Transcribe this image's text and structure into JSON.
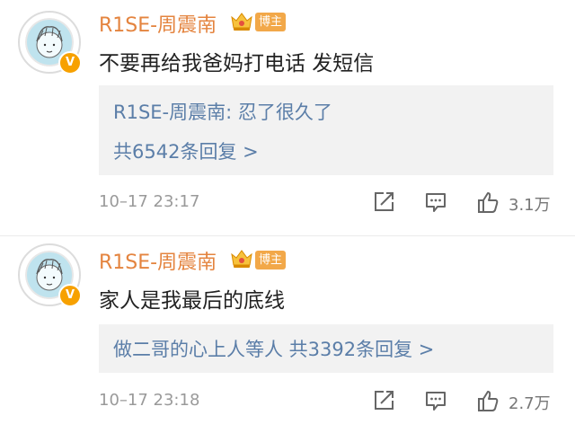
{
  "colors": {
    "username": "#e4843f",
    "link": "#5b7ea8",
    "tag_bg": "#f2a849",
    "vip_badge": "#f7a100",
    "reply_bg": "#f2f2f2"
  },
  "icons": {
    "share": "share-square-icon",
    "comment": "comment-bubble-icon",
    "like": "thumbs-up-icon",
    "crown": "crown-icon",
    "verified": "verified-v-icon"
  },
  "comments": [
    {
      "username": "R1SE-周震南",
      "tag": "博主",
      "verified_badge": "V",
      "text": "不要再给我爸妈打电话 发短信",
      "reply": {
        "line1": "R1SE-周震南: 忍了很久了",
        "line2": "共6542条回复 >"
      },
      "time": "10–17 23:17",
      "likes": "3.1万"
    },
    {
      "username": "R1SE-周震南",
      "tag": "博主",
      "verified_badge": "V",
      "text": "家人是我最后的底线",
      "reply": {
        "line1": "做二哥的心上人等人  共3392条回复 >"
      },
      "time": "10–17 23:18",
      "likes": "2.7万"
    }
  ]
}
